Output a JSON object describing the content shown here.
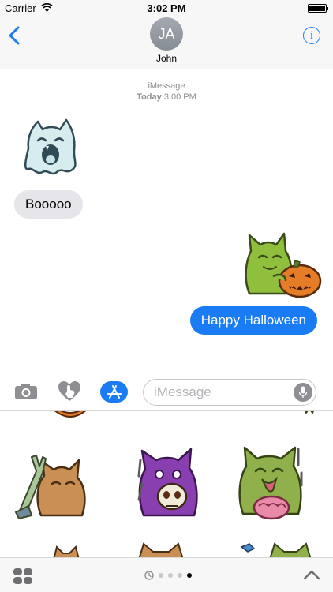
{
  "status_bar": {
    "carrier": "Carrier",
    "time": "3:02 PM",
    "icons": [
      "wifi-icon",
      "battery-icon"
    ]
  },
  "header": {
    "back_icon": "chevron-left-icon",
    "avatar_initials": "JA",
    "contact_name": "John",
    "info_icon_glyph": "i"
  },
  "conversation": {
    "service": "iMessage",
    "date_label": "Today",
    "time": "3:00 PM",
    "messages": [
      {
        "type": "sticker",
        "direction": "incoming",
        "sticker": "ghost-cat-sticker"
      },
      {
        "type": "text",
        "direction": "incoming",
        "text": "Booooo"
      },
      {
        "type": "sticker",
        "direction": "outgoing",
        "sticker": "green-cat-pumpkin-sticker"
      },
      {
        "type": "text",
        "direction": "outgoing",
        "text": "Happy Halloween"
      }
    ]
  },
  "input_bar": {
    "icons": [
      "camera-icon",
      "digital-touch-icon",
      "app-store-icon",
      "microphone-icon"
    ],
    "placeholder": "iMessage",
    "value": ""
  },
  "sticker_drawer": {
    "stickers": [
      "zombie-hand-cat-sticker",
      "purple-cat-skull-sticker",
      "green-cat-brain-sticker"
    ]
  },
  "bottom_bar": {
    "icons": [
      "app-drawer-icon",
      "recents-clock-icon",
      "chevron-up-icon"
    ],
    "page_count": 5,
    "active_page": 4
  },
  "colors": {
    "accent": "#1a7cf5",
    "incoming_bubble": "#e5e5ea",
    "bar_background": "#f7f7f7"
  }
}
